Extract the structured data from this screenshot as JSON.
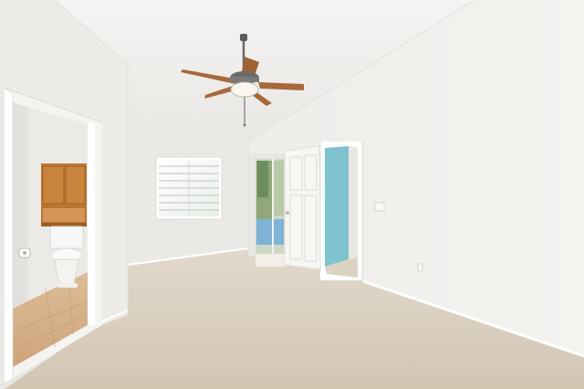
{
  "scene": {
    "colors": {
      "ceiling": "#f1f0ee",
      "wall_left": "#ecebe8",
      "wall_right": "#f3f2ef",
      "wall_back": "#ebeae6",
      "carpet": "#d9cfbf",
      "trim": "#ffffff",
      "cabinet": "#c07a35",
      "tile": "#d8b48c",
      "accent_teal": "#7fc3cf",
      "fan_blade": "#a8683a"
    },
    "icons": [
      "ceiling-fan-icon",
      "toilet-icon",
      "toilet-paper-icon",
      "light-switch-icon",
      "outlet-icon"
    ]
  }
}
